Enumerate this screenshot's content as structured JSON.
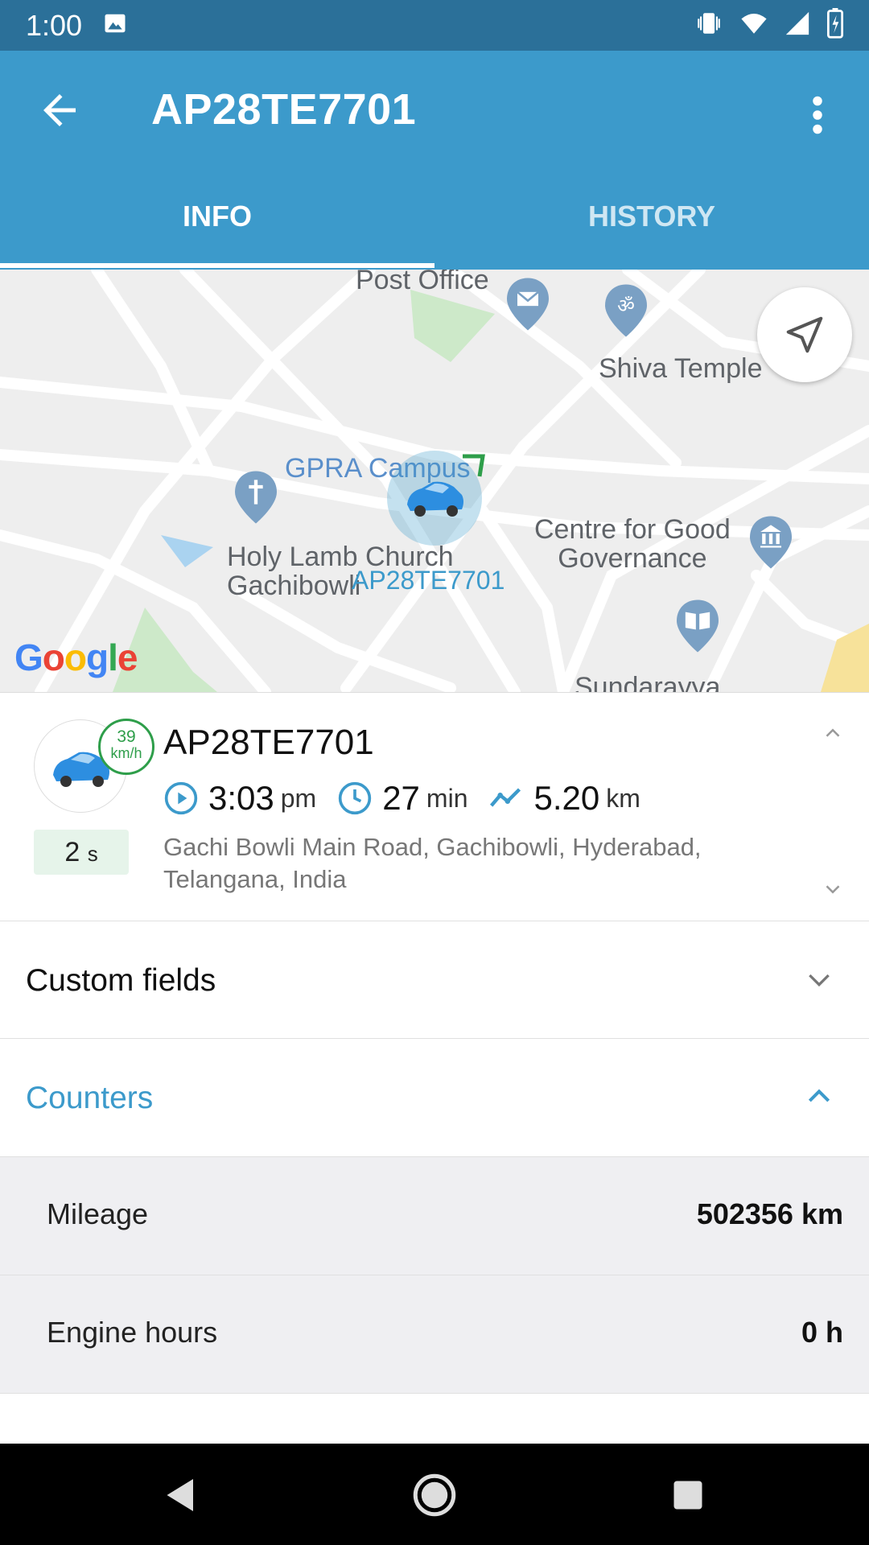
{
  "status_bar": {
    "time": "1:00"
  },
  "app_bar": {
    "title": "AP28TE7701"
  },
  "tabs": [
    {
      "label": "INFO"
    },
    {
      "label": "HISTORY"
    }
  ],
  "map": {
    "labels": {
      "post_office": "Post Office",
      "shiva_temple": "Shiva Temple",
      "gpra_campus": "GPRA Campus",
      "holy_lamb": "Holy Lamb Church\nGachibowli",
      "unit_marker": "AP28TE7701",
      "centre_good_gov": "Centre for Good\nGovernance",
      "sundarayya": "Sundarayya"
    },
    "google": "Google"
  },
  "unit": {
    "name": "AP28TE7701",
    "speed_value": "39",
    "speed_unit": "km/h",
    "age_value": "2",
    "age_unit": "s",
    "time_value": "3:03",
    "time_unit": "pm",
    "duration_value": "27",
    "duration_unit": "min",
    "distance_value": "5.20",
    "distance_unit": "km",
    "address": "Gachi Bowli Main Road, Gachibowli, Hyderabad, Telangana, India"
  },
  "sections": {
    "custom_fields": "Custom fields",
    "counters": "Counters"
  },
  "counters": [
    {
      "label": "Mileage",
      "value": "502356 km"
    },
    {
      "label": "Engine hours",
      "value": "0 h"
    }
  ],
  "colors": {
    "accent": "#3c9acb",
    "status_bar": "#2b7099",
    "speed_badge": "#2e9e4a"
  }
}
